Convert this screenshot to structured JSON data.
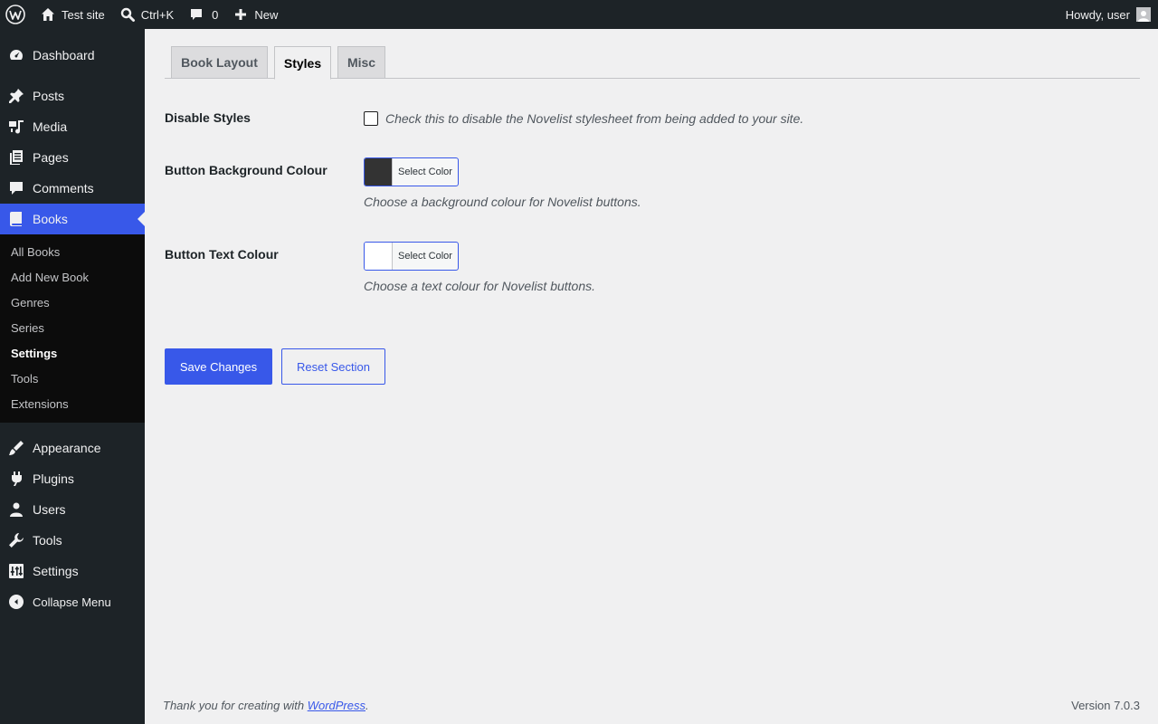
{
  "adminbar": {
    "site_name": "Test site",
    "search_shortcut": "Ctrl+K",
    "comments_count": "0",
    "new_label": "New",
    "howdy": "Howdy, user"
  },
  "sidebar": {
    "items_top": [
      {
        "label": "Dashboard",
        "icon": "dashboard-icon"
      },
      {
        "label": "Posts",
        "icon": "pin-icon"
      },
      {
        "label": "Media",
        "icon": "media-icon"
      },
      {
        "label": "Pages",
        "icon": "pages-icon"
      },
      {
        "label": "Comments",
        "icon": "comment-icon"
      },
      {
        "label": "Books",
        "icon": "book-icon"
      }
    ],
    "submenu": [
      "All Books",
      "Add New Book",
      "Genres",
      "Series",
      "Settings",
      "Tools",
      "Extensions"
    ],
    "items_bottom": [
      {
        "label": "Appearance",
        "icon": "brush-icon"
      },
      {
        "label": "Plugins",
        "icon": "plugin-icon"
      },
      {
        "label": "Users",
        "icon": "user-icon"
      },
      {
        "label": "Tools",
        "icon": "wrench-icon"
      },
      {
        "label": "Settings",
        "icon": "settings-icon"
      }
    ],
    "collapse": "Collapse Menu"
  },
  "tabs": [
    "Book Layout",
    "Styles",
    "Misc"
  ],
  "fields": {
    "disable_styles": {
      "label": "Disable Styles",
      "description": "Check this to disable the Novelist stylesheet from being added to your site."
    },
    "button_bg": {
      "label": "Button Background Colour",
      "button_text": "Select Color",
      "color": "#333333",
      "description": "Choose a background colour for Novelist buttons."
    },
    "button_text": {
      "label": "Button Text Colour",
      "button_text": "Select Color",
      "color": "#ffffff",
      "description": "Choose a text colour for Novelist buttons."
    }
  },
  "actions": {
    "save": "Save Changes",
    "reset": "Reset Section"
  },
  "footer": {
    "thanks_prefix": "Thank you for creating with ",
    "link": "WordPress",
    "suffix": ".",
    "version": "Version 7.0.3"
  },
  "colors": {
    "accent": "#3858e9",
    "adminbar": "#1d2327",
    "submenu_bg": "#0c0c0c"
  }
}
